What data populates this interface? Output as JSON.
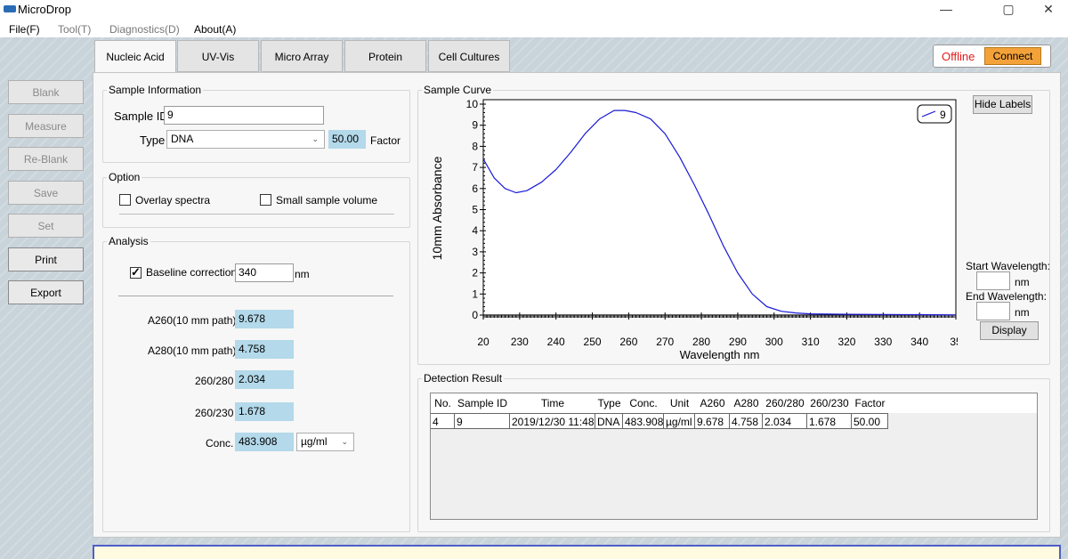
{
  "window": {
    "title": "MicroDrop",
    "minimize": "—",
    "maximize": "▢",
    "close": "✕"
  },
  "menu": [
    "File(F)",
    "Tool(T)",
    "Diagnostics(D)",
    "About(A)"
  ],
  "tabs": [
    "Nucleic Acid",
    "UV-Vis",
    "Micro Array",
    "Protein",
    "Cell Cultures"
  ],
  "connection": {
    "status": "Offline",
    "button": "Connect",
    "status_color": "#e21b1b",
    "button_color": "#f3a23a"
  },
  "sidebar": [
    "Blank",
    "Measure",
    "Re-Blank",
    "Save",
    "Set",
    "Print",
    "Export"
  ],
  "sample_info": {
    "title": "Sample Information",
    "sample_id_label": "Sample ID",
    "sample_id": "9",
    "type_label": "Type",
    "type": "DNA",
    "factor_value": "50.00",
    "factor_label": "Factor"
  },
  "option": {
    "title": "Option",
    "overlay": "Overlay spectra",
    "small_volume": "Small sample volume"
  },
  "analysis": {
    "title": "Analysis",
    "baseline_label": "Baseline correction",
    "baseline_value": "340",
    "baseline_unit": "nm",
    "a260_label": "A260(10 mm path)",
    "a260": "9.678",
    "a280_label": "A280(10 mm path)",
    "a280": "4.758",
    "r260_280_label": "260/280",
    "r260_280": "2.034",
    "r260_230_label": "260/230",
    "r260_230": "1.678",
    "conc_label": "Conc.",
    "conc": "483.908",
    "conc_unit": "µg/ml"
  },
  "curve": {
    "title": "Sample Curve",
    "hide_labels": "Hide Labels",
    "start_label": "Start Wavelength:",
    "start_unit": "nm",
    "end_label": "End Wavelength:",
    "end_unit": "nm",
    "display": "Display"
  },
  "chart_data": {
    "type": "line",
    "xlabel": "Wavelength nm",
    "ylabel": "10mm Absorbance",
    "xlim": [
      220,
      350
    ],
    "ylim": [
      0,
      10
    ],
    "x_ticks": [
      "20",
      "230",
      "240",
      "250",
      "260",
      "270",
      "280",
      "290",
      "300",
      "310",
      "320",
      "330",
      "340",
      "35"
    ],
    "y_ticks": [
      "0",
      "1",
      "2",
      "3",
      "4",
      "5",
      "6",
      "7",
      "8",
      "9",
      "10"
    ],
    "legend": "top-right",
    "series": [
      {
        "name": "9",
        "color": "#1a1ad6",
        "x": [
          220,
          223,
          226,
          229,
          232,
          236,
          240,
          244,
          248,
          252,
          256,
          259,
          262,
          266,
          270,
          274,
          278,
          282,
          286,
          290,
          294,
          298,
          302,
          306,
          310,
          320,
          330,
          340,
          350
        ],
        "y": [
          7.4,
          6.5,
          6.0,
          5.8,
          5.9,
          6.3,
          6.9,
          7.7,
          8.6,
          9.3,
          9.7,
          9.7,
          9.6,
          9.3,
          8.6,
          7.5,
          6.2,
          4.8,
          3.3,
          2.0,
          1.0,
          0.4,
          0.18,
          0.1,
          0.06,
          0.04,
          0.03,
          0.02,
          0.01
        ]
      }
    ]
  },
  "detection": {
    "title": "Detection Result",
    "columns": [
      "No.",
      "Sample ID",
      "Time",
      "Type",
      "Conc.",
      "Unit",
      "A260",
      "A280",
      "260/280",
      "260/230",
      "Factor"
    ],
    "rows": [
      [
        "4",
        "9",
        "2019/12/30 11:48",
        "DNA",
        "483.908",
        "µg/ml",
        "9.678",
        "4.758",
        "2.034",
        "1.678",
        "50.00"
      ]
    ]
  }
}
